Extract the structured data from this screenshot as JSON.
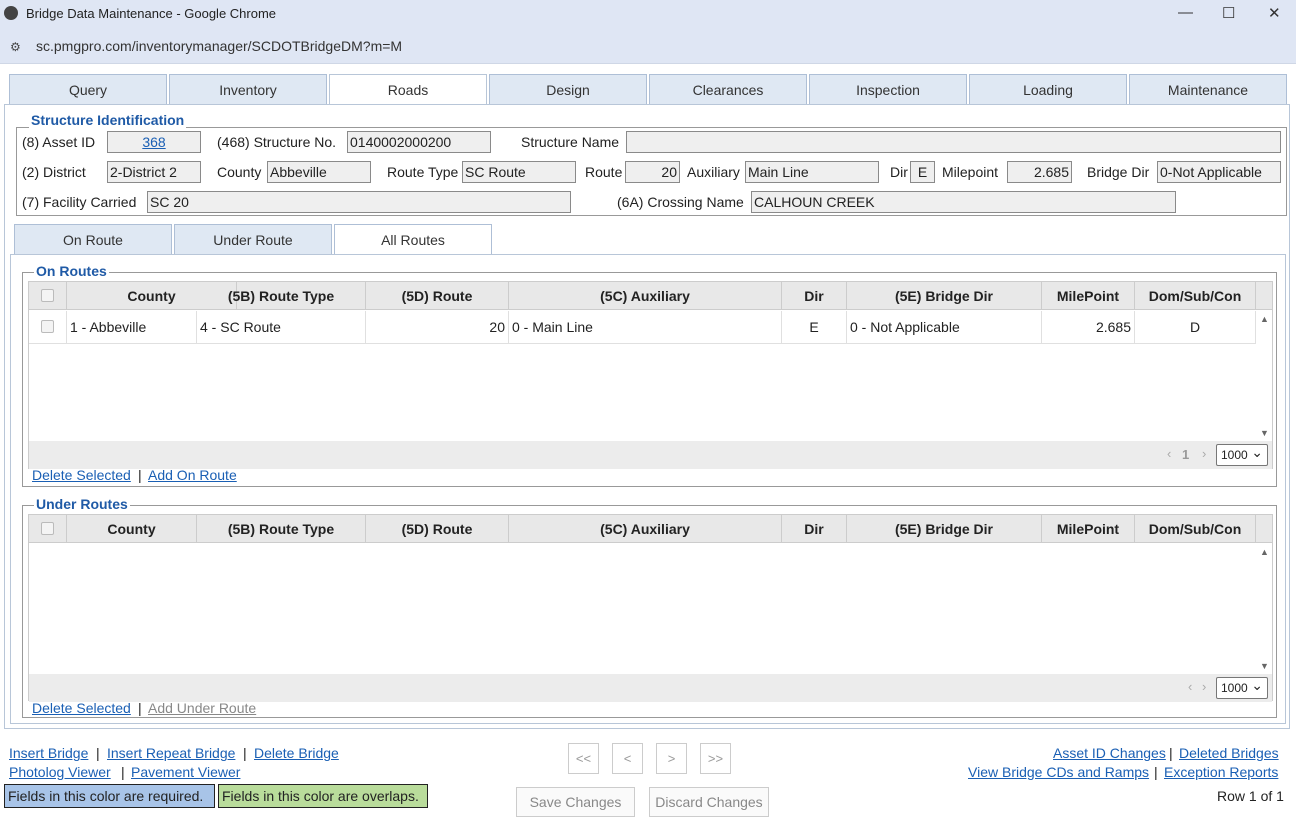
{
  "window": {
    "title": "Bridge Data Maintenance - Google Chrome",
    "url": "sc.pmgpro.com/inventorymanager/SCDOTBridgeDM?m=M",
    "controls": {
      "minimize": "—",
      "maximize": "☐",
      "close": "✕"
    }
  },
  "tabs": [
    "Query",
    "Inventory",
    "Roads",
    "Design",
    "Clearances",
    "Inspection",
    "Loading",
    "Maintenance"
  ],
  "structure_id": {
    "legend": "Structure Identification",
    "asset_id_label": "(8) Asset ID",
    "asset_id": "368",
    "structure_no_label": "(468) Structure No.",
    "structure_no": "0140002000200",
    "structure_name_label": "Structure Name",
    "structure_name": "",
    "district_label": "(2) District",
    "district": "2-District 2",
    "county_label": "County",
    "county": "Abbeville",
    "route_type_label": "Route Type",
    "route_type": "SC Route",
    "route_label": "Route",
    "route": "20",
    "auxiliary_label": "Auxiliary",
    "auxiliary": "Main Line",
    "dir_label": "Dir",
    "dir": "E",
    "milepoint_label": "Milepoint",
    "milepoint": "2.685",
    "bridge_dir_label": "Bridge Dir",
    "bridge_dir": "0-Not Applicable",
    "facility_label": "(7) Facility Carried",
    "facility": "SC 20",
    "crossing_label": "(6A) Crossing Name",
    "crossing": "CALHOUN CREEK"
  },
  "subtabs": [
    "On Route",
    "Under Route",
    "All Routes"
  ],
  "columns": [
    "County",
    "(5B) Route Type",
    "(5D) Route",
    "(5C) Auxiliary",
    "Dir",
    "(5E) Bridge Dir",
    "MilePoint",
    "Dom/Sub/Con"
  ],
  "on_routes": {
    "legend": "On Routes",
    "rows": [
      {
        "county": "1 - Abbeville",
        "route_type": "4 - SC Route",
        "route": "20",
        "auxiliary": "0 - Main Line",
        "dir": "E",
        "bridge_dir": "0 - Not Applicable",
        "milepoint": "2.685",
        "dsc": "D"
      }
    ],
    "page": "1",
    "page_size": "1000",
    "delete_link": "Delete Selected",
    "sep": "|",
    "add_link": "Add On Route"
  },
  "under_routes": {
    "legend": "Under Routes",
    "page_size": "1000",
    "delete_link": "Delete Selected",
    "sep": "|",
    "add_link": "Add Under Route"
  },
  "pager_glyphs": {
    "prev": "‹",
    "next": "›"
  },
  "footer": {
    "insert_bridge": "Insert Bridge",
    "insert_repeat": "Insert Repeat Bridge",
    "delete_bridge": "Delete Bridge",
    "photolog": "Photolog Viewer",
    "pavement": "Pavement Viewer",
    "sep": "|",
    "nav": [
      "<<",
      "<",
      ">",
      ">>"
    ],
    "save": "Save Changes",
    "discard": "Discard Changes",
    "asset_changes": "Asset ID Changes",
    "deleted_bridges": "Deleted Bridges",
    "view_cds": "View Bridge CDs and Ramps",
    "exception_reports": "Exception Reports",
    "row_status": "Row 1 of 1",
    "required_legend": "Fields in this color are required.",
    "overlap_legend": "Fields in this color are overlaps."
  },
  "colors": {
    "required": "#a8c4e8",
    "overlap": "#b9dc9b",
    "link": "#1a5fb4",
    "legend": "#1f5aa6"
  }
}
